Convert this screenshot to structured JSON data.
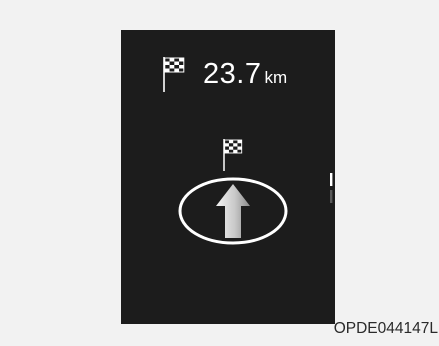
{
  "navigation": {
    "distance_value": "23.7",
    "distance_unit": "km",
    "destination_icon": "checkered-flag-icon",
    "maneuver": "straight",
    "maneuver_icon": "straight-arrow-icon"
  },
  "figure": {
    "code": "OPDE044147L"
  },
  "colors": {
    "screen_background": "#1c1c1c",
    "page_background": "#f2f2f2",
    "text": "#ffffff"
  }
}
